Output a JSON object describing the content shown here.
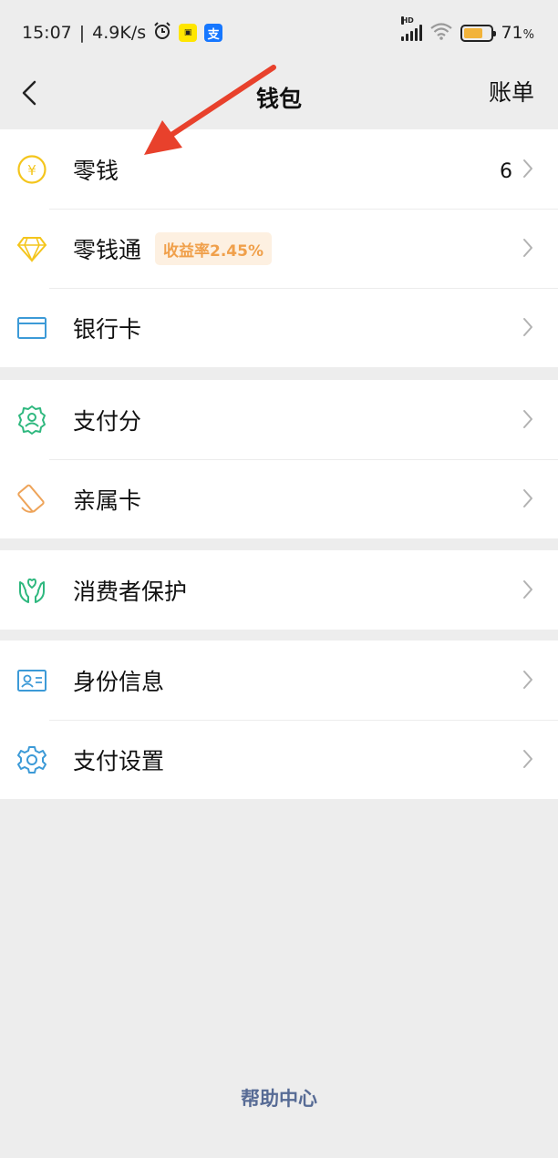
{
  "status_bar": {
    "time": "15:07",
    "speed": "4.9K/s",
    "signal_label": "HD",
    "battery_percent": "71",
    "battery_unit": "%",
    "battery_level": 0.71,
    "icons": [
      "alarm-icon",
      "app-badge-yellow-icon",
      "alipay-icon",
      "signal-icon",
      "wifi-icon",
      "battery-icon"
    ]
  },
  "nav": {
    "title": "钱包",
    "right_label": "账单"
  },
  "groups": [
    {
      "rows": [
        {
          "label": "零钱",
          "icon": "yuan-coin-icon",
          "value": "6"
        },
        {
          "label": "零钱通",
          "icon": "diamond-icon",
          "tag": "收益率2.45%"
        },
        {
          "label": "银行卡",
          "icon": "bank-card-icon"
        }
      ]
    },
    {
      "rows": [
        {
          "label": "支付分",
          "icon": "pay-score-icon"
        },
        {
          "label": "亲属卡",
          "icon": "family-card-icon"
        }
      ]
    },
    {
      "rows": [
        {
          "label": "消费者保护",
          "icon": "consumer-protection-icon"
        }
      ]
    },
    {
      "rows": [
        {
          "label": "身份信息",
          "icon": "id-card-icon"
        },
        {
          "label": "支付设置",
          "icon": "settings-gear-icon"
        }
      ]
    }
  ],
  "footer": {
    "help_label": "帮助中心"
  },
  "colors": {
    "background": "#ededed",
    "link": "#576b95",
    "tag_text": "#f0a04b",
    "tag_bg": "#fdf0e1",
    "annotation_arrow": "#e8412c"
  }
}
